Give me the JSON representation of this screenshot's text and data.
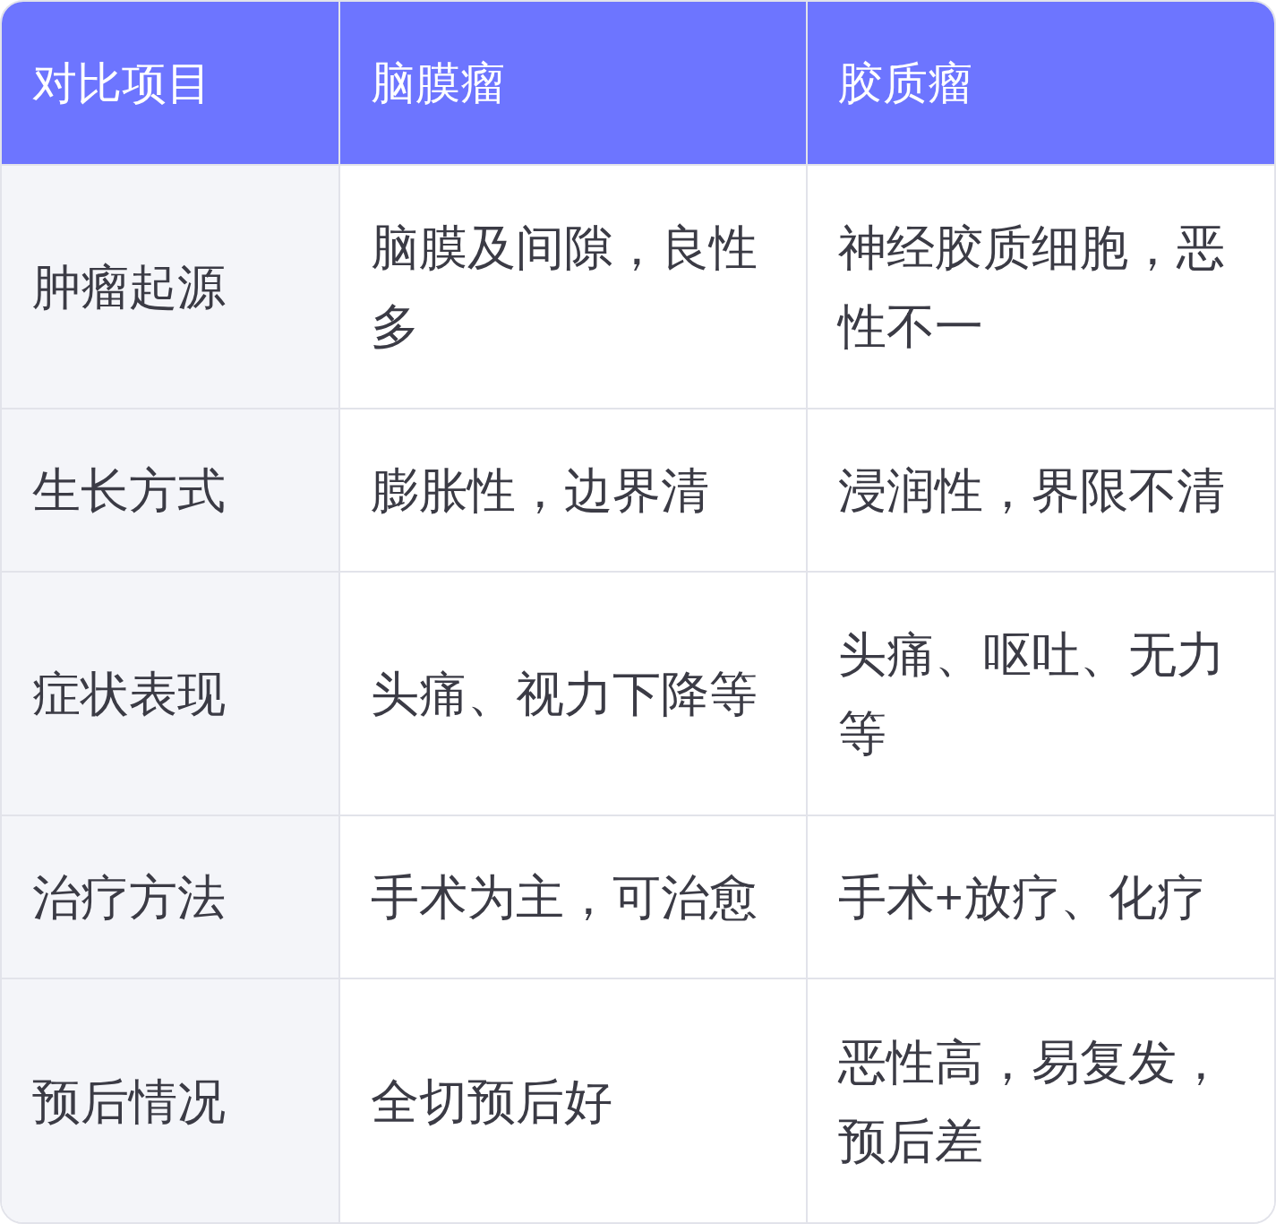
{
  "table": {
    "columns": [
      "对比项目",
      "脑膜瘤",
      "胶质瘤"
    ],
    "rows": [
      {
        "cells": [
          "肿瘤起源",
          "脑膜及间隙，良性多",
          "神经胶质细胞，恶性不一"
        ]
      },
      {
        "cells": [
          "生长方式",
          "膨胀性，边界清",
          "浸润性，界限不清"
        ]
      },
      {
        "cells": [
          "症状表现",
          "头痛、视力下降等",
          "头痛、呕吐、无力等"
        ]
      },
      {
        "cells": [
          "治疗方法",
          "手术为主，可治愈",
          "手术+放疗、化疗"
        ]
      },
      {
        "cells": [
          "预后情况",
          "全切预后好",
          "恶性高，易复发，预后差"
        ]
      }
    ]
  }
}
